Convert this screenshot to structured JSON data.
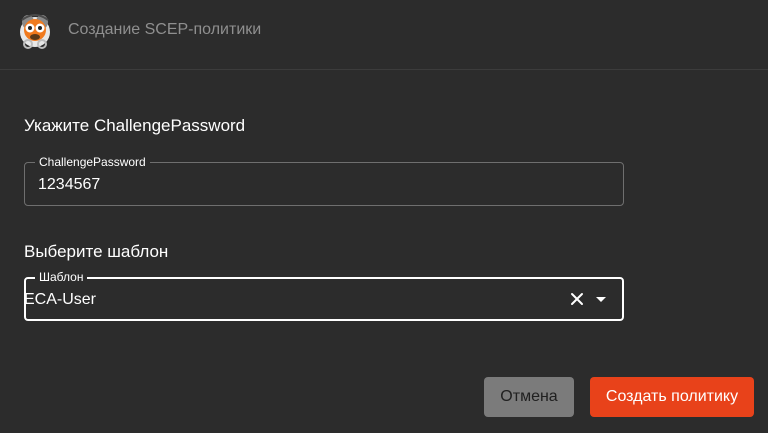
{
  "header": {
    "title": "Создание SCEP-политики",
    "logo_icon": "mascot-logo-icon"
  },
  "challenge_section": {
    "title": "Укажите ChallengePassword",
    "field_label": "ChallengePassword",
    "field_value": "1234567"
  },
  "template_section": {
    "title": "Выберите шаблон",
    "field_label": "Шаблон",
    "field_value": "ECA-User",
    "clear_icon": "close-icon",
    "dropdown_icon": "caret-down-icon"
  },
  "actions": {
    "cancel_label": "Отмена",
    "submit_label": "Создать политику"
  },
  "colors": {
    "background": "#2c2c2c",
    "primary": "#e8421a",
    "cancel": "#7b7b7b"
  }
}
